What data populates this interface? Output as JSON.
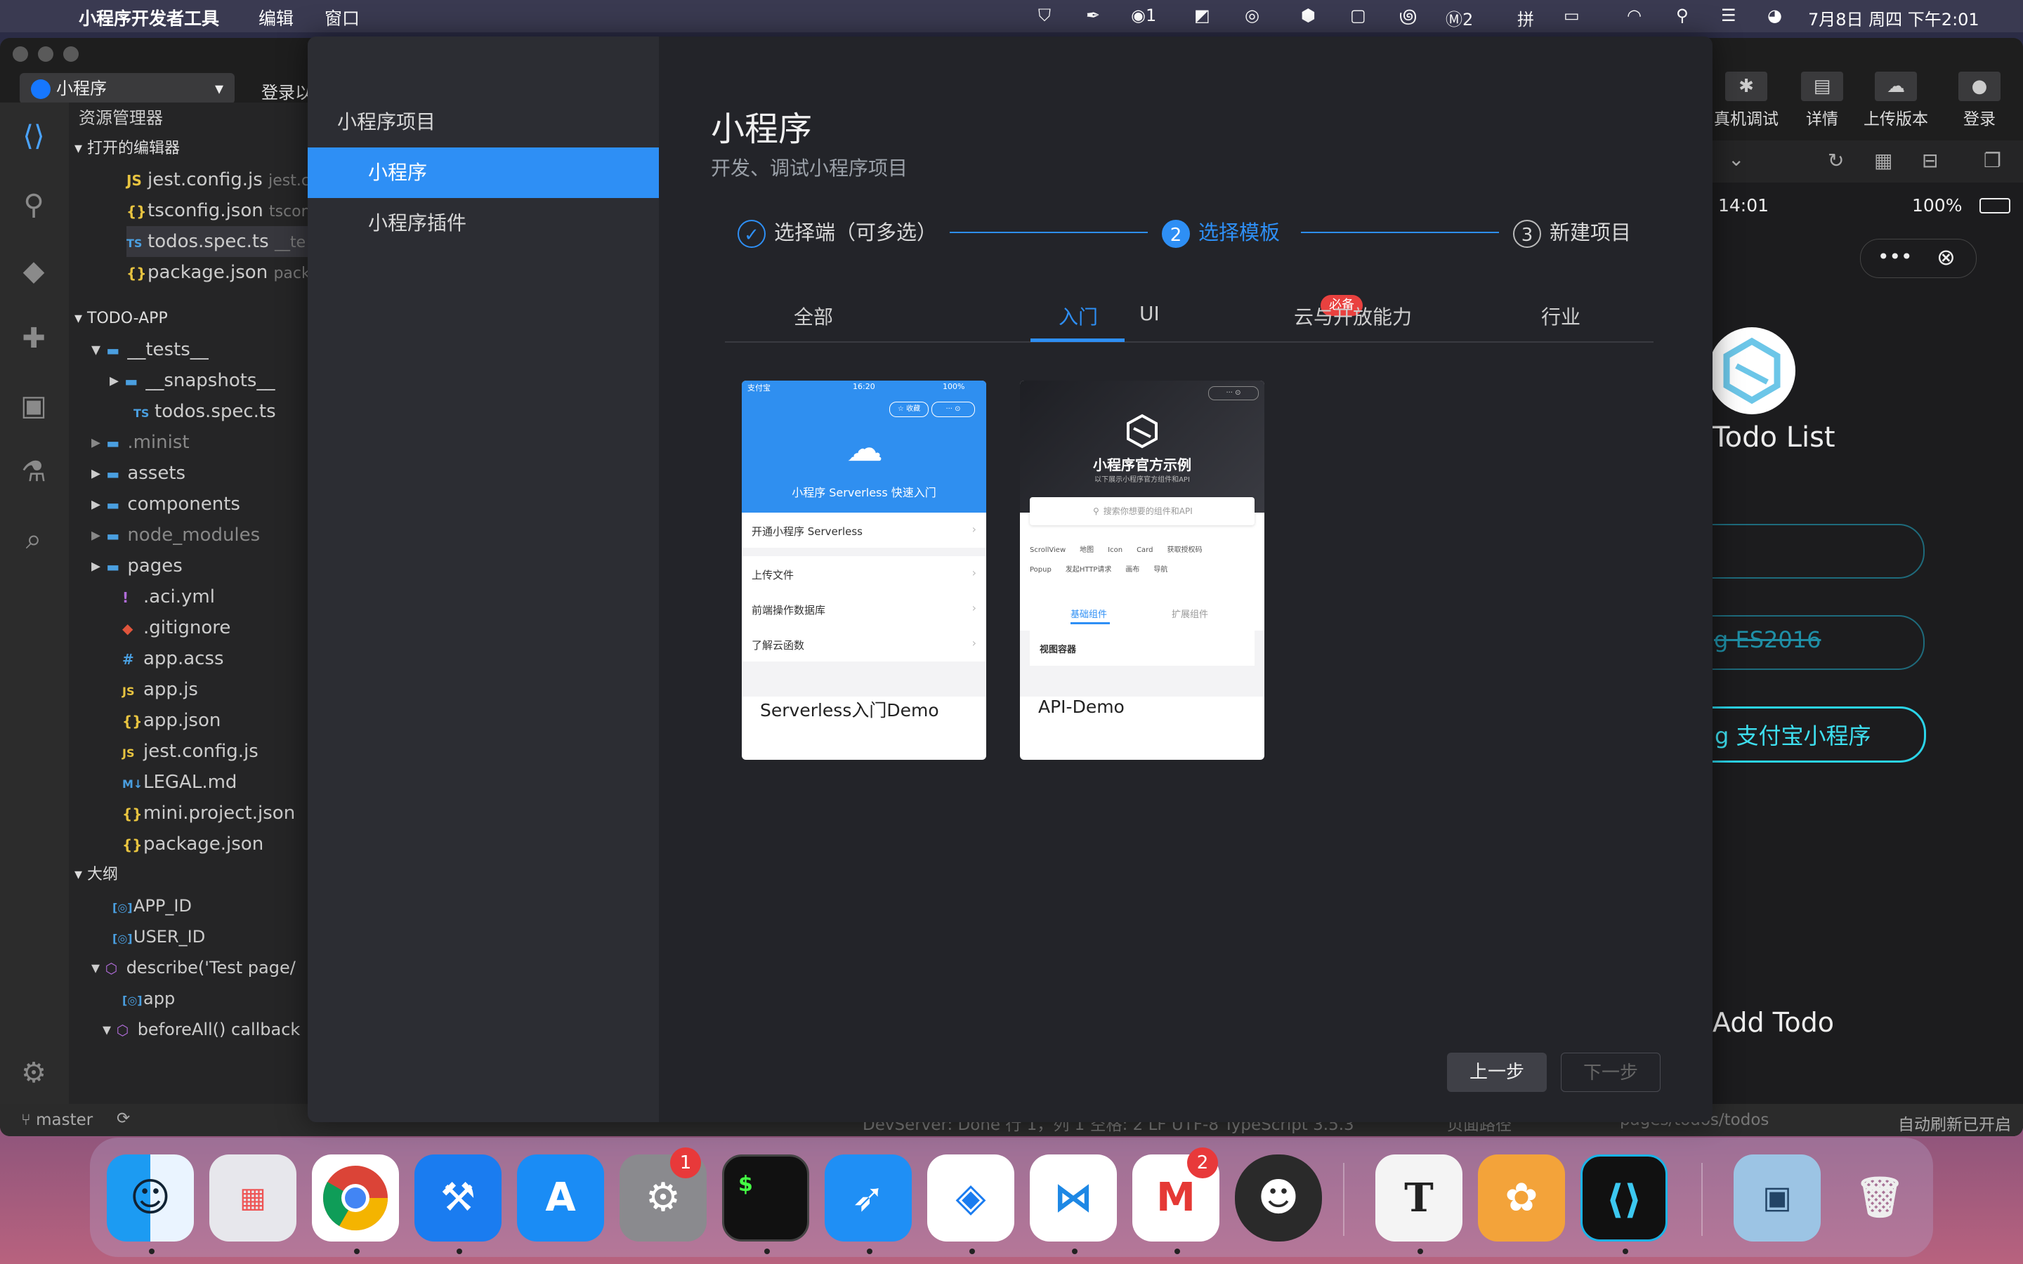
{
  "menubar": {
    "app_name": "小程序开发者工具",
    "menu_edit": "编辑",
    "menu_window": "窗口",
    "tray_badge_1": "1",
    "tray_badge_m": "2",
    "clock": "7月8日 周四 下午2:01"
  },
  "ide": {
    "project_selector": "小程序",
    "login_partial": "登录以",
    "toolbar": {
      "debug": "真机调试",
      "details": "详情",
      "upload": "上传版本",
      "login": "登录"
    },
    "explorer": {
      "title": "资源管理器",
      "open_editors": "打开的编辑器",
      "open_files": [
        {
          "name": "jest.config.js",
          "hint": "jest.c",
          "icon": "JS"
        },
        {
          "name": "tsconfig.json",
          "hint": "tscon",
          "icon": "{}"
        },
        {
          "name": "todos.spec.ts",
          "hint": "__te",
          "icon": "TS"
        },
        {
          "name": "package.json",
          "hint": "pack",
          "icon": "{}"
        }
      ],
      "project": "TODO-APP",
      "tree": [
        {
          "name": "__tests__",
          "icon": "folder"
        },
        {
          "name": "__snapshots__",
          "icon": "folder"
        },
        {
          "name": "todos.spec.ts",
          "icon": "TS"
        },
        {
          "name": ".minist",
          "icon": "folder"
        },
        {
          "name": "assets",
          "icon": "folder"
        },
        {
          "name": "components",
          "icon": "folder"
        },
        {
          "name": "node_modules",
          "icon": "folder"
        },
        {
          "name": "pages",
          "icon": "folder"
        },
        {
          "name": ".aci.yml",
          "icon": "!"
        },
        {
          "name": ".gitignore",
          "icon": "git"
        },
        {
          "name": "app.acss",
          "icon": "#"
        },
        {
          "name": "app.js",
          "icon": "JS"
        },
        {
          "name": "app.json",
          "icon": "{}"
        },
        {
          "name": "jest.config.js",
          "icon": "JS"
        },
        {
          "name": "LEGAL.md",
          "icon": "M"
        },
        {
          "name": "mini.project.json",
          "icon": "{}"
        },
        {
          "name": "package.json",
          "icon": "{}"
        }
      ],
      "outline": "大纲",
      "outline_items": [
        "APP_ID",
        "USER_ID",
        "describe('Test page/",
        "app",
        "beforeAll() callback"
      ]
    },
    "status": {
      "branch": "master",
      "middle": "DevServer: Done    行 1，列 1    空格: 2    LF    UTF-8    TypeScript    3.5.3",
      "path_label": "页面路径",
      "path": "pages/todos/todos",
      "auto_refresh": "自动刷新已开启"
    }
  },
  "simulator": {
    "time": "14:01",
    "battery": "100%",
    "app_title": "Todo List",
    "item1": "g ES2016",
    "item2": "g 支付宝小程序",
    "add": "Add Todo"
  },
  "dialog": {
    "nav_title": "小程序项目",
    "nav_items": [
      "小程序",
      "小程序插件"
    ],
    "title": "小程序",
    "subtitle": "开发、调试小程序项目",
    "steps": [
      {
        "num": "✓",
        "label": "选择端（可多选）"
      },
      {
        "num": "2",
        "label": "选择模板"
      },
      {
        "num": "3",
        "label": "新建项目"
      }
    ],
    "tabs": [
      "全部",
      "入门",
      "UI",
      "云与开放能力",
      "行业"
    ],
    "badge": "必备",
    "cards": [
      {
        "name": "Serverless入门Demo",
        "header": "小程序 Serverless 快速入门",
        "status_left": "支付宝",
        "status_mid": "16:20",
        "status_right": "100%",
        "collect": "收藏",
        "items": [
          "开通小程序 Serverless",
          "上传文件",
          "前端操作数据库",
          "了解云函数"
        ]
      },
      {
        "name": "API-Demo",
        "header": "小程序官方示例",
        "sub": "以下展示小程序官方组件和API",
        "search": "搜索你想要的组件和API",
        "chips": [
          "ScrollView",
          "地图",
          "Icon",
          "Card",
          "获取授权码",
          "Popup",
          "发起HTTP请求",
          "画布",
          "导航"
        ],
        "tab_a": "基础组件",
        "tab_b": "扩展组件",
        "section": "视图容器"
      }
    ],
    "prev": "上一步",
    "next": "下一步"
  },
  "dock": {
    "apps": [
      "finder-icon",
      "launchpad-icon",
      "chrome-icon",
      "xcode-icon",
      "app-store-icon",
      "system-preferences-icon",
      "terminal-icon",
      "dingtalk-icon",
      "alipay-icon",
      "vscode-icon",
      "mail-icon",
      "antman-icon",
      "typora-icon",
      "paw-icon",
      "mini-dev-tool-icon",
      "preview-icon",
      "trash-icon"
    ],
    "badge_prefs": "1",
    "badge_mail": "2",
    "terminal_glyph": "$",
    "typora_glyph": "T"
  }
}
